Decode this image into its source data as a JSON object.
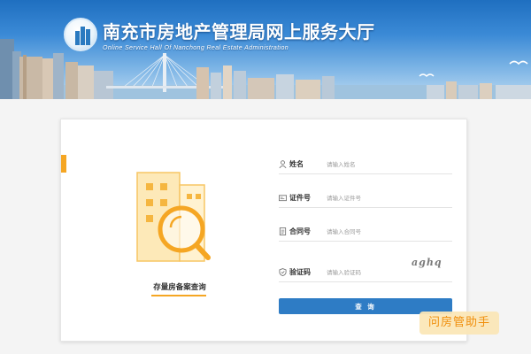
{
  "header": {
    "title": "南充市房地产管理局网上服务大厅",
    "subtitle": "Online Service Hall Of Nanchong Real Estate Administration"
  },
  "colors": {
    "accent": "#f5a623",
    "primary_button": "#2e7cc5",
    "banner_sky": "#2f7fcf"
  },
  "query": {
    "caption": "存量房备案查询",
    "fields": [
      {
        "icon": "person-icon",
        "label": "姓名",
        "placeholder": "请输入姓名"
      },
      {
        "icon": "id-card-icon",
        "label": "证件号",
        "placeholder": "请输入证件号"
      },
      {
        "icon": "document-icon",
        "label": "合同号",
        "placeholder": "请输入合同号"
      },
      {
        "icon": "shield-icon",
        "label": "验证码",
        "placeholder": "请输入验证码"
      }
    ],
    "captcha_text": "aghq",
    "submit_label": "查 询"
  },
  "watermark": {
    "text": "问房管助手"
  }
}
